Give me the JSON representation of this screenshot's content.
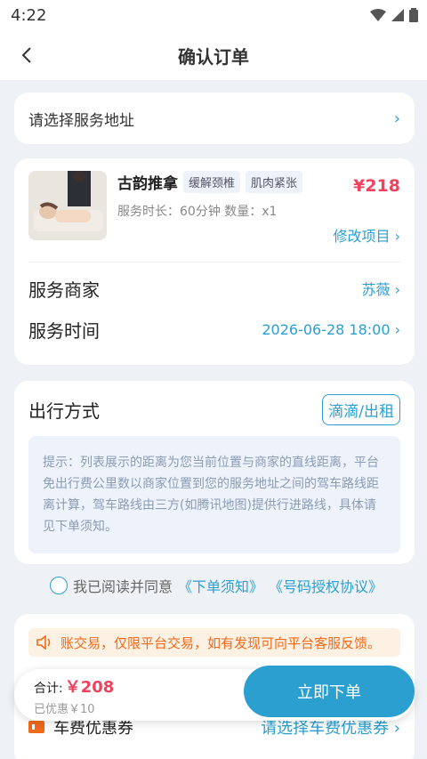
{
  "status": {
    "time": "4:22"
  },
  "nav": {
    "title": "确认订单"
  },
  "address": {
    "placeholder": "请选择服务地址"
  },
  "service": {
    "name": "古韵推拿",
    "tags": [
      "缓解颈椎",
      "肌肉紧张"
    ],
    "price": "¥218",
    "meta": "服务时长：60分钟  数量：x1",
    "modify_label": "修改项目",
    "merchant_label": "服务商家",
    "merchant_value": "苏薇",
    "time_label": "服务时间",
    "time_value": "2026-06-28 18:00"
  },
  "travel": {
    "title": "出行方式",
    "mode": "滴滴/出租",
    "tip": "提示：列表展示的距离为您当前位置与商家的直线距离，平台免出行费公里数以商家位置到您的服务地址之间的驾车路线距离计算，驾车路线由三方(如腾讯地图)提供行进路线，具体请见下单须知。"
  },
  "agreement": {
    "text": "我已阅读并同意",
    "link1": "《下单须知》",
    "link2": "《号码授权协议》"
  },
  "notice": {
    "text": "账交易，仅限平台交易，如有发现可向平台客服反馈。"
  },
  "coupon": {
    "label": "车费优惠券",
    "action": "请选择车费优惠券"
  },
  "footer": {
    "total_label": "合计:",
    "total_amount": "￥208",
    "discount": "已优惠￥10",
    "submit": "立即下单"
  },
  "colors": {
    "accent": "#2a9fd0",
    "price": "#f0425f",
    "notice": "#f06a1a"
  }
}
